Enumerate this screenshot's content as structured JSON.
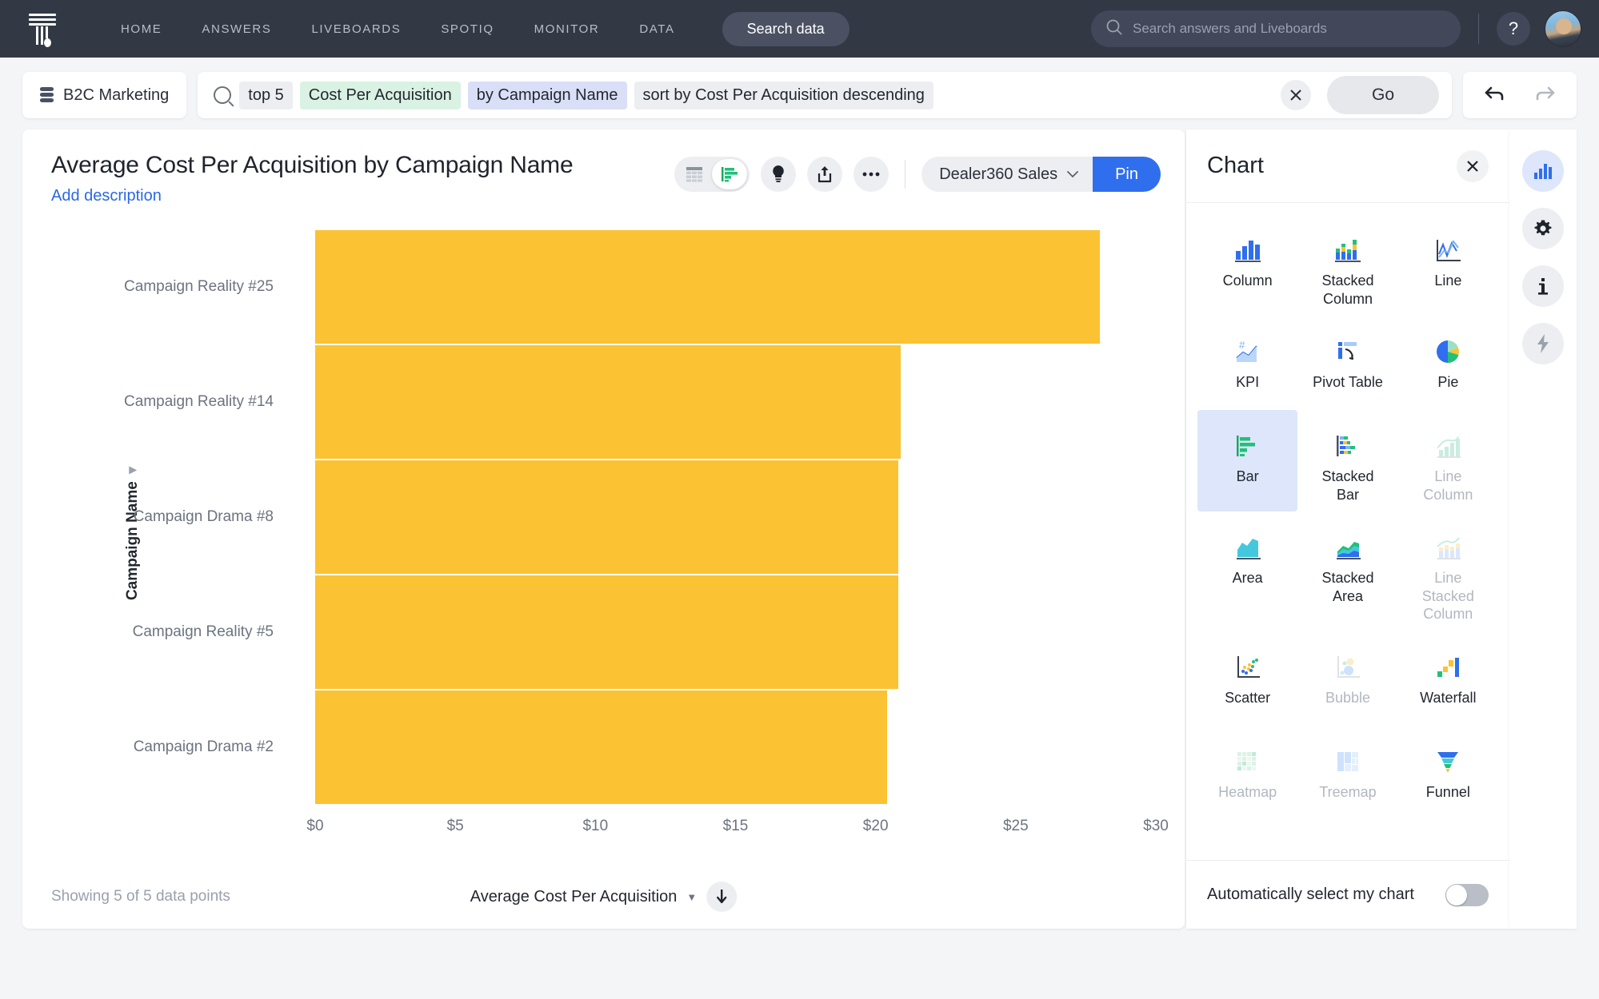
{
  "topnav": {
    "logo_name": "thoughtspot-logo",
    "links": [
      "HOME",
      "ANSWERS",
      "LIVEBOARDS",
      "SPOTIQ",
      "MONITOR",
      "DATA"
    ],
    "search_data_label": "Search data",
    "global_search_placeholder": "Search answers and Liveboards",
    "help_label": "?",
    "bg_color": "#333845"
  },
  "searchrow": {
    "source": "B2C Marketing",
    "tokens": [
      {
        "text": "top 5",
        "kind": "plain"
      },
      {
        "text": "Cost Per Acquisition",
        "kind": "measure"
      },
      {
        "text": "by Campaign Name",
        "kind": "attribute"
      },
      {
        "text": "sort by Cost Per Acquisition descending",
        "kind": "plain"
      }
    ],
    "clear_label": "✕",
    "go_label": "Go",
    "undo_label": "undo",
    "redo_label": "redo"
  },
  "answer": {
    "title": "Average Cost Per Acquisition by Campaign Name",
    "add_description": "Add description",
    "tools": {
      "table_view": "table-view",
      "chart_view": "chart-view",
      "spotiq_label": "spotiq",
      "share_label": "share",
      "more_label": "•••"
    },
    "pin_target": "Dealer360 Sales",
    "pin_label": "Pin",
    "footer": {
      "showing": "Showing 5 of 5 data points",
      "legend_label": "Average Cost Per Acquisition",
      "sort_icon": "sort-descending-icon"
    }
  },
  "chart_data": {
    "type": "bar",
    "title": "Average Cost Per Acquisition by Campaign Name",
    "xlabel": "",
    "ylabel": "Campaign Name",
    "categories": [
      "Campaign Reality #25",
      "Campaign Reality #14",
      "Campaign Drama #8",
      "Campaign Reality #5",
      "Campaign Drama #2"
    ],
    "series": [
      {
        "name": "Average Cost Per Acquisition",
        "values": [
          28.0,
          20.9,
          20.8,
          20.8,
          20.4
        ]
      }
    ],
    "xlim": [
      0,
      30
    ],
    "xticks": [
      0,
      5,
      10,
      15,
      20,
      25,
      30
    ],
    "xticklabels": [
      "$0",
      "$5",
      "$10",
      "$15",
      "$20",
      "$25",
      "$30"
    ],
    "bar_color": "#fbc233",
    "grid": false,
    "legend_position": "bottom-center",
    "orientation": "horizontal"
  },
  "chart_panel": {
    "title": "Chart",
    "close_label": "✕",
    "types": [
      {
        "label": "Column",
        "icon": "column-chart-icon",
        "state": "enabled"
      },
      {
        "label": "Stacked\nColumn",
        "icon": "stacked-column-chart-icon",
        "state": "enabled"
      },
      {
        "label": "Line",
        "icon": "line-chart-icon",
        "state": "enabled"
      },
      {
        "label": "KPI",
        "icon": "kpi-chart-icon",
        "state": "enabled"
      },
      {
        "label": "Pivot Table",
        "icon": "pivot-table-icon",
        "state": "enabled"
      },
      {
        "label": "Pie",
        "icon": "pie-chart-icon",
        "state": "enabled"
      },
      {
        "label": "Bar",
        "icon": "bar-chart-icon",
        "state": "selected"
      },
      {
        "label": "Stacked\nBar",
        "icon": "stacked-bar-chart-icon",
        "state": "enabled"
      },
      {
        "label": "Line\nColumn",
        "icon": "line-column-chart-icon",
        "state": "disabled"
      },
      {
        "label": "Area",
        "icon": "area-chart-icon",
        "state": "enabled"
      },
      {
        "label": "Stacked\nArea",
        "icon": "stacked-area-chart-icon",
        "state": "enabled"
      },
      {
        "label": "Line\nStacked\nColumn",
        "icon": "line-stacked-column-chart-icon",
        "state": "disabled"
      },
      {
        "label": "Scatter",
        "icon": "scatter-chart-icon",
        "state": "enabled"
      },
      {
        "label": "Bubble",
        "icon": "bubble-chart-icon",
        "state": "disabled"
      },
      {
        "label": "Waterfall",
        "icon": "waterfall-chart-icon",
        "state": "enabled"
      },
      {
        "label": "Heatmap",
        "icon": "heatmap-chart-icon",
        "state": "disabled"
      },
      {
        "label": "Treemap",
        "icon": "treemap-chart-icon",
        "state": "disabled"
      },
      {
        "label": "Funnel",
        "icon": "funnel-chart-icon",
        "state": "enabled"
      }
    ],
    "auto_select_label": "Automatically select my chart",
    "auto_select_on": false,
    "selected_accent": "#dde6fa"
  },
  "rail": {
    "items": [
      {
        "name": "chart-config-icon",
        "active": true
      },
      {
        "name": "settings-gear-icon",
        "active": false
      },
      {
        "name": "info-icon",
        "active": false
      },
      {
        "name": "bolt-icon",
        "active": false
      }
    ]
  }
}
